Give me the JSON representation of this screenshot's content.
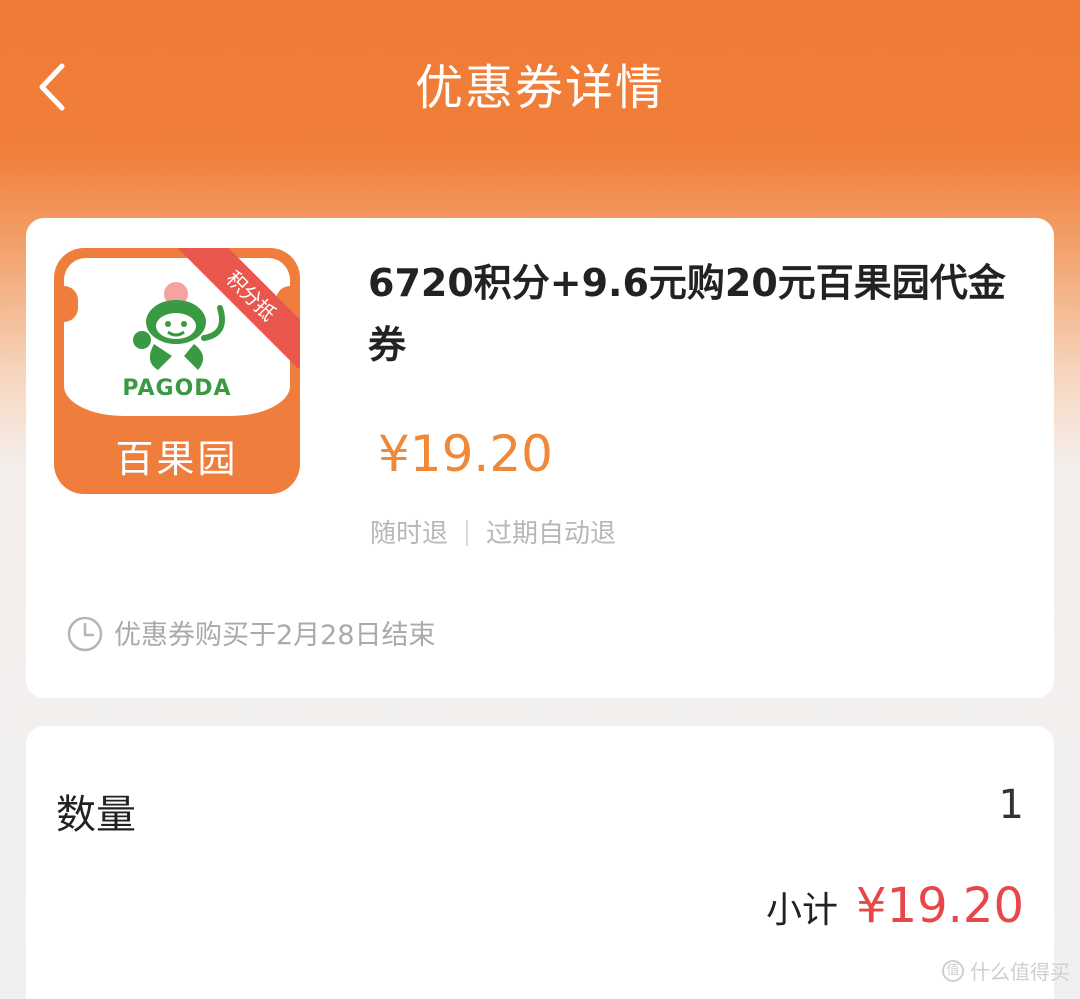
{
  "header": {
    "title": "优惠券详情",
    "back_icon": "chevron-left-icon"
  },
  "coupon": {
    "logo": {
      "ribbon": "积分抵",
      "brand_en": "PAGODA",
      "brand_cn": "百果园"
    },
    "title": "6720积分+9.6元购20元百果园代金券",
    "price": "¥19.20",
    "tags": [
      "随时退",
      "过期自动退"
    ],
    "deadline": "优惠券购买于2月28日结束"
  },
  "order": {
    "quantity_label": "数量",
    "quantity_value": "1",
    "subtotal_label": "小计",
    "subtotal_amount": "¥19.20"
  },
  "watermark": "什么值得买",
  "colors": {
    "header_orange": "#ef7a35",
    "price_orange": "#f0883a",
    "subtotal_red": "#e8474a"
  }
}
